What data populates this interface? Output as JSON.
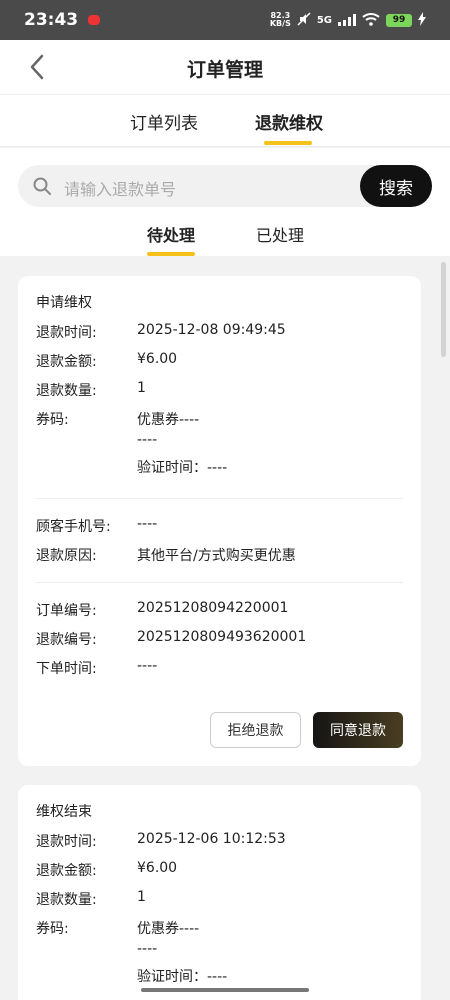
{
  "status_bar": {
    "time": "23:43",
    "net_speed_value": "82.3",
    "net_speed_unit": "KB/S",
    "network": "5G",
    "battery": "99"
  },
  "header": {
    "title": "订单管理"
  },
  "main_tabs": [
    {
      "label": "订单列表"
    },
    {
      "label": "退款维权",
      "active": true
    }
  ],
  "search": {
    "placeholder": "请输入退款单号",
    "button_label": "搜索"
  },
  "sub_tabs": [
    {
      "label": "待处理",
      "active": true
    },
    {
      "label": "已处理"
    }
  ],
  "labels": {
    "refund_time": "退款时间:",
    "refund_amount": "退款金额:",
    "refund_qty": "退款数量:",
    "coupon_code": "券码:",
    "customer_phone": "顾客手机号:",
    "refund_reason": "退款原因:",
    "order_no": "订单编号:",
    "refund_no": "退款编号:",
    "order_time": "下单时间:"
  },
  "refunds": [
    {
      "status": "申请维权",
      "refund_time": "2025-12-08 09:49:45",
      "refund_amount": "¥6.00",
      "refund_qty": "1",
      "coupon_name": "优惠券----",
      "coupon_code": "----",
      "verify_time": "验证时间：----",
      "customer_phone": "----",
      "refund_reason": "其他平台/方式购买更优惠",
      "order_no": "20251208094220001",
      "refund_no": "2025120809493620001",
      "order_time": "----",
      "reject_label": "拒绝退款",
      "agree_label": "同意退款"
    },
    {
      "status": "维权结束",
      "refund_time": "2025-12-06 10:12:53",
      "refund_amount": "¥6.00",
      "refund_qty": "1",
      "coupon_name": "优惠券----",
      "coupon_code": "----",
      "verify_time": "验证时间：----"
    }
  ],
  "colors": {
    "accent": "#f6c21a",
    "dark_button": "#111111"
  }
}
